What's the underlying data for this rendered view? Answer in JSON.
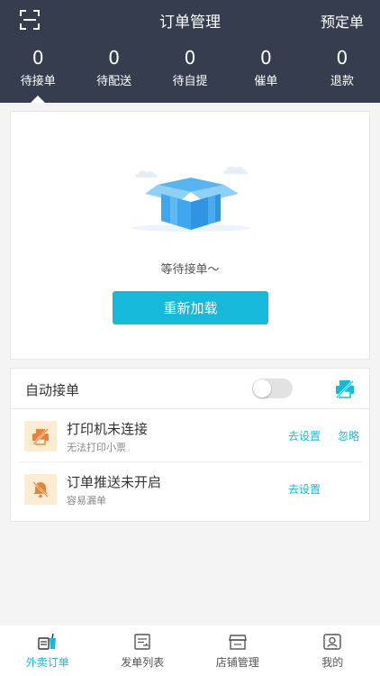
{
  "header": {
    "title": "订单管理",
    "right_action": "预定单",
    "scan_icon": "scan-icon"
  },
  "stats": [
    {
      "count": "0",
      "label": "待接单"
    },
    {
      "count": "0",
      "label": "待配送"
    },
    {
      "count": "0",
      "label": "待自提"
    },
    {
      "count": "0",
      "label": "催单"
    },
    {
      "count": "0",
      "label": "退款"
    }
  ],
  "empty": {
    "message": "等待接单～",
    "reload_label": "重新加载",
    "illustration": "open-box-icon"
  },
  "settings": {
    "auto_accept_label": "自动接单",
    "auto_accept_on": false,
    "notices": [
      {
        "icon": "printer-off-icon",
        "title": "打印机未连接",
        "subtitle": "无法打印小票",
        "action": "去设置",
        "secondary_action": "忽略"
      },
      {
        "icon": "bell-off-icon",
        "title": "订单推送未开启",
        "subtitle": "容易漏单",
        "action": "去设置"
      }
    ]
  },
  "tabbar": [
    {
      "icon": "takeout-icon",
      "label": "外卖订单",
      "active": true
    },
    {
      "icon": "dispatch-list-icon",
      "label": "发单列表",
      "active": false
    },
    {
      "icon": "store-icon",
      "label": "店铺管理",
      "active": false
    },
    {
      "icon": "profile-icon",
      "label": "我的",
      "active": false
    }
  ],
  "colors": {
    "header_bg": "#353d4e",
    "accent": "#17b9db",
    "warning_bg": "#fdecd4",
    "warning_icon": "#e8823a"
  }
}
